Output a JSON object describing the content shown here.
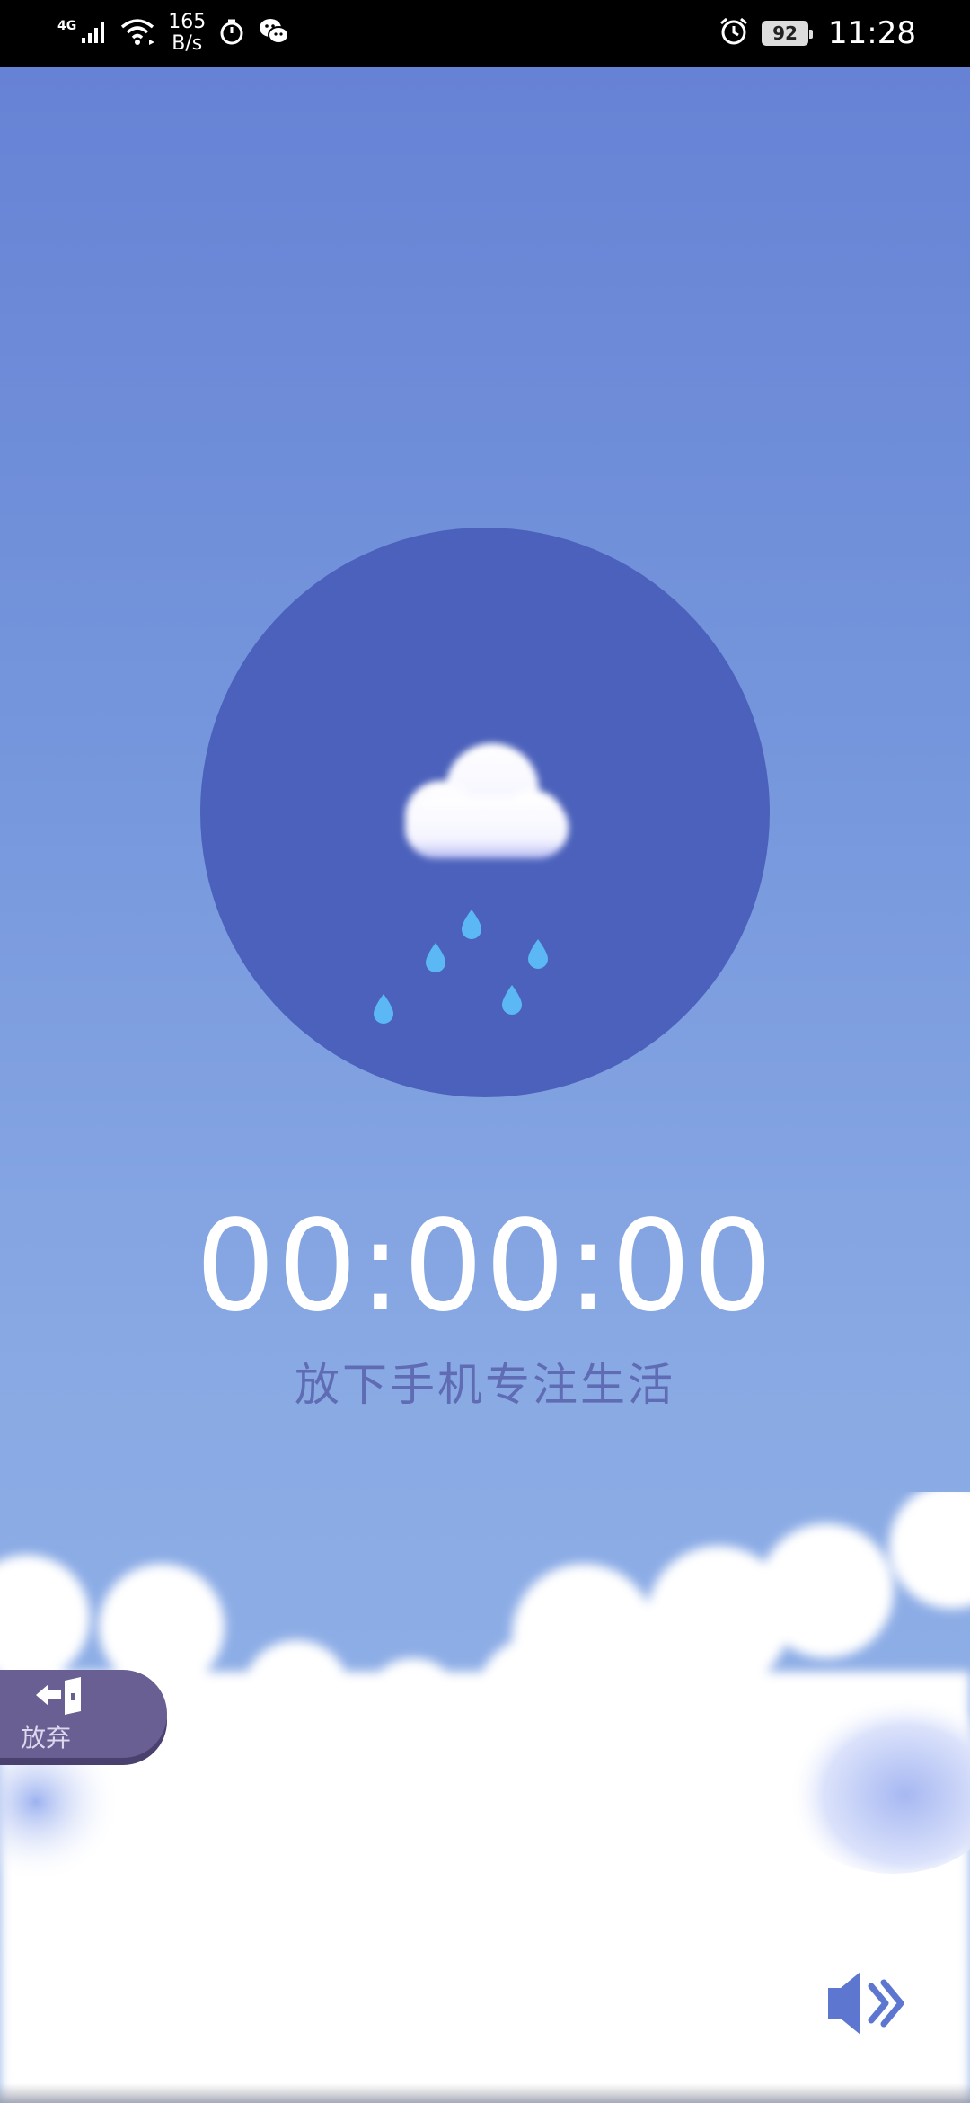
{
  "status_bar": {
    "network": "4G",
    "speed_value": "165",
    "speed_unit": "B/s",
    "battery": "92",
    "time": "11:28",
    "icons": [
      "signal-icon",
      "wifi-icon",
      "timer-icon",
      "wechat-icon",
      "alarm-icon",
      "battery-icon"
    ]
  },
  "focus": {
    "timer": "00:00:00",
    "slogan": "放下手机专注生活",
    "scene_icon": "rain-cloud-icon"
  },
  "controls": {
    "give_up_label": "放弃",
    "give_up_icon": "exit-door-icon",
    "sound_icon": "speaker-icon"
  },
  "colors": {
    "circle": "#4b61bb",
    "raindrop": "#5bb8f5",
    "give_up_bg": "#6a5f92",
    "sound_icon": "#5d77d1"
  }
}
